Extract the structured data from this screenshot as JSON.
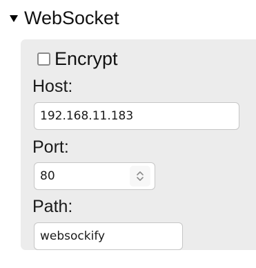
{
  "section": {
    "title": "WebSocket",
    "expanded": true,
    "icon": "triangle-down-icon"
  },
  "encrypt": {
    "label": "Encrypt",
    "checked": false
  },
  "host": {
    "label": "Host:",
    "value": "192.168.11.183"
  },
  "port": {
    "label": "Port:",
    "value": "80",
    "icon": "spinner-icon"
  },
  "path": {
    "label": "Path:",
    "value": "websockify"
  },
  "colors": {
    "panel_background": "#ececec",
    "input_border": "#c6c6c6",
    "text": "#1a1a1a"
  }
}
